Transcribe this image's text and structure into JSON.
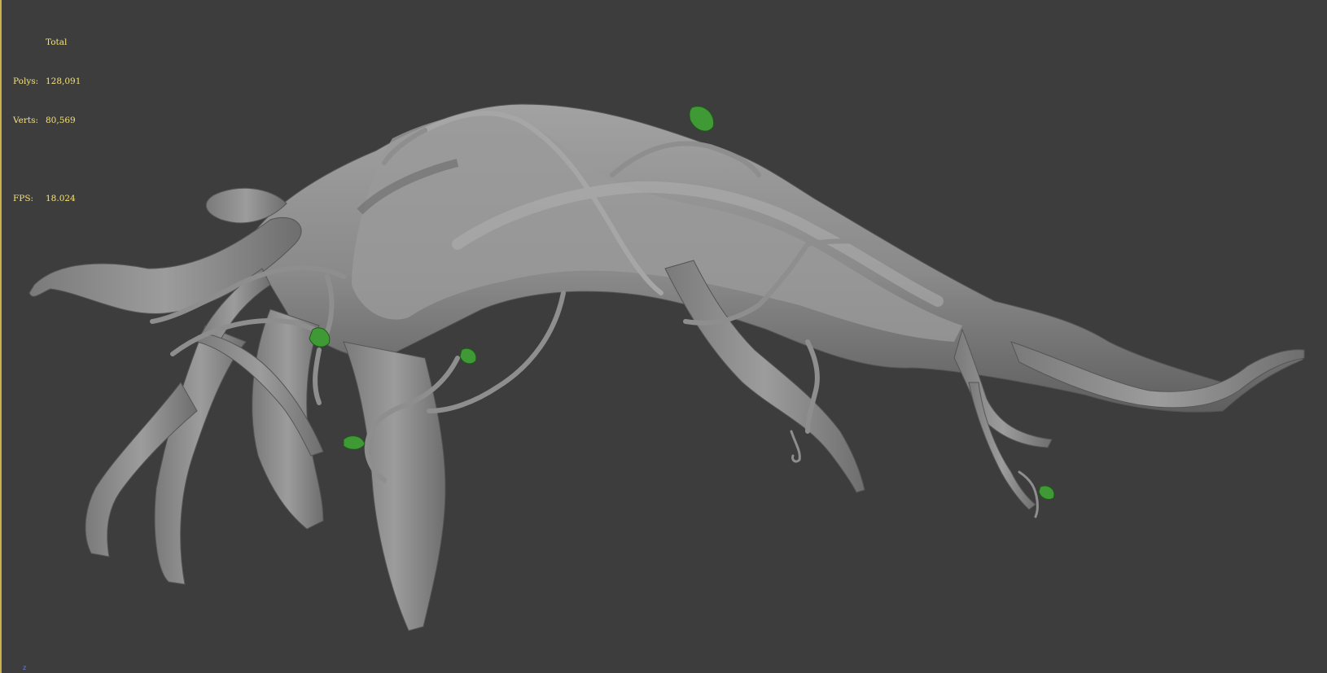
{
  "viewport": {
    "background_color": "#3d3d3d",
    "stats_text_color": "#f4e27a",
    "model_color": "#8c8c8c",
    "leaf_color": "#3f9a36"
  },
  "stats": {
    "total_label": "Total",
    "polys_label": "Polys:",
    "polys_value": "128,091",
    "verts_label": "Verts:",
    "verts_value": "80,569",
    "fps_label": "FPS:",
    "fps_value": "18.024"
  },
  "axis_gizmo": {
    "label": "z"
  },
  "model": {
    "icon": "tree-roots-model"
  }
}
